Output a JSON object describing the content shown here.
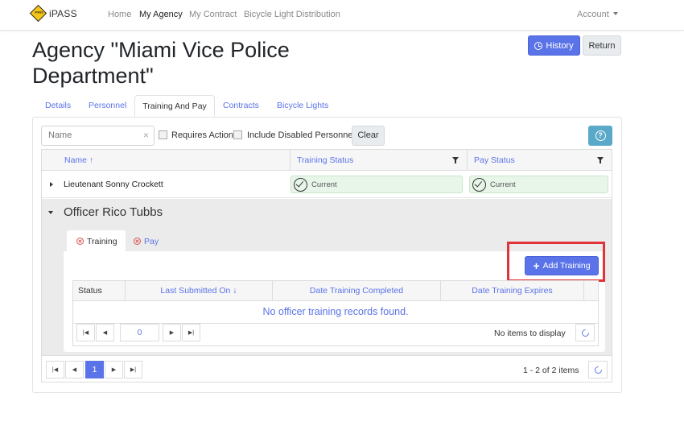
{
  "navbar": {
    "brand_logo_text": "iPASS",
    "brand": "iPASS",
    "links": [
      "Home",
      "My Agency",
      "My Contract",
      "Bicycle Light Distribution"
    ],
    "active_link": "My Agency",
    "account": "Account"
  },
  "page": {
    "title": "Agency \"Miami Vice Police Department\"",
    "history_label": "History",
    "return_label": "Return"
  },
  "tabs": [
    "Details",
    "Personnel",
    "Training And Pay",
    "Contracts",
    "Bicycle Lights"
  ],
  "active_tab": "Training And Pay",
  "filters": {
    "name_placeholder": "Name",
    "requires_action": "Requires Action",
    "include_disabled": "Include Disabled Personnel",
    "clear": "Clear",
    "help_icon_text": "?"
  },
  "grid": {
    "columns": [
      "Name ↑",
      "Training Status",
      "Pay Status"
    ],
    "rows": [
      {
        "name": "Lieutenant Sonny Crockett",
        "training_status": "Current",
        "pay_status": "Current"
      },
      {
        "name": "Officer Rico Tubbs"
      }
    ]
  },
  "detail": {
    "tabs": [
      "Training",
      "Pay"
    ],
    "add_training": "Add Training",
    "columns": [
      "Status",
      "Last Submitted On ↓",
      "Date Training Completed",
      "Date Training Expires"
    ],
    "empty_message": "No officer training records found.",
    "page_value": "0",
    "no_items": "No items to display"
  },
  "pager": {
    "current_page": "1",
    "info": "1 - 2 of 2 items"
  },
  "colors": {
    "accent": "#5b73e8",
    "highlight": "#e0333a",
    "success_bg": "#e8f5e9"
  }
}
